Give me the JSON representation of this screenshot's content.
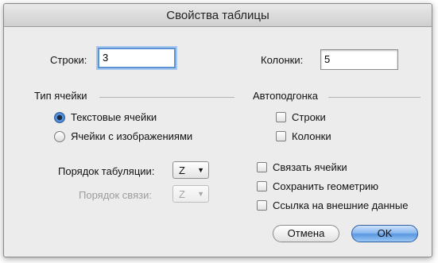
{
  "dialog": {
    "title": "Свойства таблицы"
  },
  "fields": {
    "rows_label": "Строки:",
    "rows_value": "3",
    "cols_label": "Колонки:",
    "cols_value": "5"
  },
  "cell_type": {
    "heading": "Тип ячейки",
    "options": [
      "Текстовые ячейки",
      "Ячейки с изображениями"
    ],
    "selected": "Текстовые ячейки"
  },
  "autofit": {
    "heading": "Автоподгонка",
    "rows": "Строки",
    "cols": "Колонки"
  },
  "tab_order": {
    "label": "Порядок табуляции:",
    "value": "Z"
  },
  "link_order": {
    "label": "Порядок связи:",
    "value": "Z"
  },
  "options": {
    "link_cells": "Связать ячейки",
    "keep_geometry": "Сохранить геометрию",
    "external_data_link": "Ссылка на внешние данные"
  },
  "buttons": {
    "cancel": "Отмена",
    "ok": "OK"
  }
}
